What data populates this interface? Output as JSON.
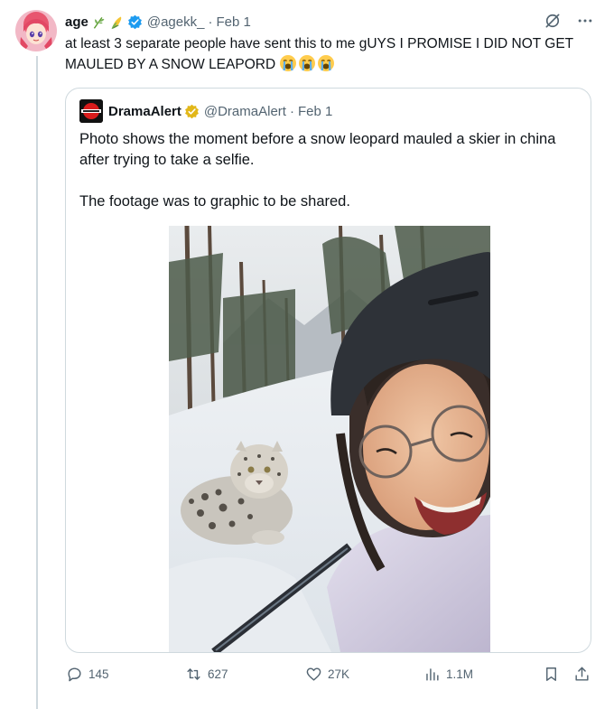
{
  "tweet": {
    "display_name": "age",
    "handle": "@agekk_",
    "separator": "·",
    "date": "Feb 1",
    "text": "at least 3 separate people have sent this to me gUYS I PROMISE I DID NOT GET MAULED BY A SNOW LEAPORD"
  },
  "quote": {
    "display_name": "DramaAlert",
    "handle": "@DramaAlert",
    "separator": "·",
    "date": "Feb 1",
    "paragraph1": "Photo shows the moment before a snow leopard mauled a skier in china after trying to take a selfie.",
    "paragraph2": "The footage was to graphic to be shared."
  },
  "actions": {
    "replies": "145",
    "reposts": "627",
    "likes": "27K",
    "views": "1.1M"
  },
  "colors": {
    "text": "#0f1419",
    "secondary": "#536471",
    "verified_blue": "#1d9bf0",
    "verified_gold": "#e2b719",
    "border": "#cfd9de"
  },
  "icons": [
    "herb-emoji",
    "corn-emoji",
    "verified-badge",
    "grok-icon",
    "more-icon",
    "loudly-crying-emoji",
    "reply-icon",
    "repost-icon",
    "like-icon",
    "views-icon",
    "bookmark-icon",
    "share-icon"
  ]
}
